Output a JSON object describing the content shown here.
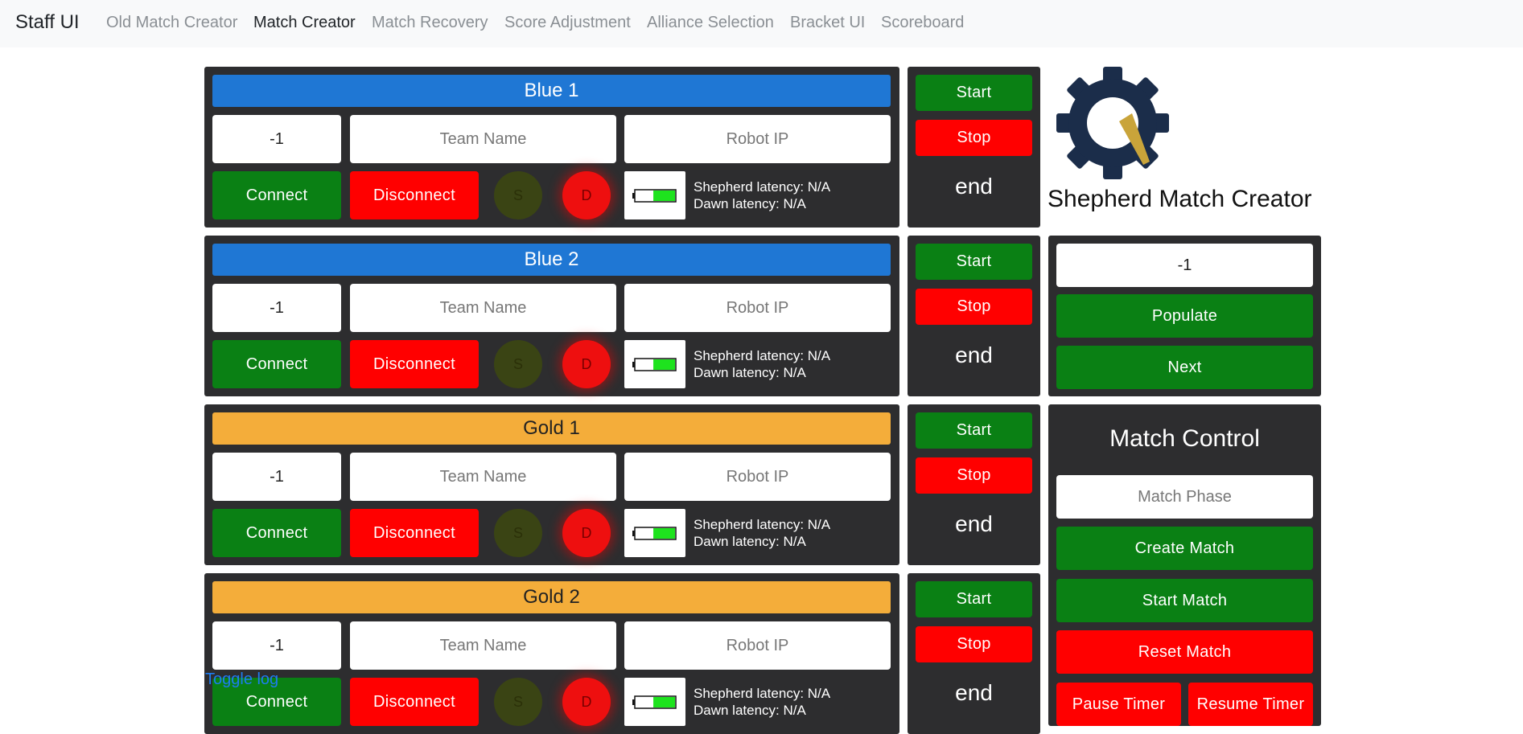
{
  "app": {
    "brand": "Staff UI"
  },
  "nav": [
    {
      "label": "Old Match Creator",
      "active": false
    },
    {
      "label": "Match Creator",
      "active": true
    },
    {
      "label": "Match Recovery",
      "active": false
    },
    {
      "label": "Score Adjustment",
      "active": false
    },
    {
      "label": "Alliance Selection",
      "active": false
    },
    {
      "label": "Bracket UI",
      "active": false
    },
    {
      "label": "Scoreboard",
      "active": false
    }
  ],
  "robots": [
    {
      "title": "Blue 1",
      "alliance": "blue",
      "team_number": "-1",
      "team_name_placeholder": "Team Name",
      "robot_ip_placeholder": "Robot IP",
      "connect": "Connect",
      "disconnect": "Disconnect",
      "s": "S",
      "d": "D",
      "shepherd_latency": "Shepherd latency: N/A",
      "dawn_latency": "Dawn latency: N/A",
      "start": "Start",
      "stop": "Stop",
      "end": "end",
      "battery_level": 0.55
    },
    {
      "title": "Blue 2",
      "alliance": "blue",
      "team_number": "-1",
      "team_name_placeholder": "Team Name",
      "robot_ip_placeholder": "Robot IP",
      "connect": "Connect",
      "disconnect": "Disconnect",
      "s": "S",
      "d": "D",
      "shepherd_latency": "Shepherd latency: N/A",
      "dawn_latency": "Dawn latency: N/A",
      "start": "Start",
      "stop": "Stop",
      "end": "end",
      "battery_level": 0.55
    },
    {
      "title": "Gold 1",
      "alliance": "gold",
      "team_number": "-1",
      "team_name_placeholder": "Team Name",
      "robot_ip_placeholder": "Robot IP",
      "connect": "Connect",
      "disconnect": "Disconnect",
      "s": "S",
      "d": "D",
      "shepherd_latency": "Shepherd latency: N/A",
      "dawn_latency": "Dawn latency: N/A",
      "start": "Start",
      "stop": "Stop",
      "end": "end",
      "battery_level": 0.55
    },
    {
      "title": "Gold 2",
      "alliance": "gold",
      "team_number": "-1",
      "team_name_placeholder": "Team Name",
      "robot_ip_placeholder": "Robot IP",
      "connect": "Connect",
      "disconnect": "Disconnect",
      "s": "S",
      "d": "D",
      "shepherd_latency": "Shepherd latency: N/A",
      "dawn_latency": "Dawn latency: N/A",
      "start": "Start",
      "stop": "Stop",
      "end": "end",
      "battery_level": 0.55
    }
  ],
  "logo": {
    "title": "Shepherd Match Creator",
    "icon": "gear-gauge-logo"
  },
  "match_number": {
    "value": "-1",
    "populate": "Populate",
    "next": "Next"
  },
  "match_control": {
    "title": "Match Control",
    "phase_placeholder": "Match Phase",
    "create": "Create Match",
    "start": "Start Match",
    "reset": "Reset Match",
    "pause": "Pause Timer",
    "resume": "Resume Timer"
  },
  "toggle_log": "Toggle log",
  "colors": {
    "green": "#0a8014",
    "red": "#ff0000",
    "blue": "#1f77d4",
    "gold": "#f4ad3a",
    "panel": "#2d2d2f",
    "logo_navy": "#1b2d4a",
    "logo_gold": "#c9a43a"
  }
}
